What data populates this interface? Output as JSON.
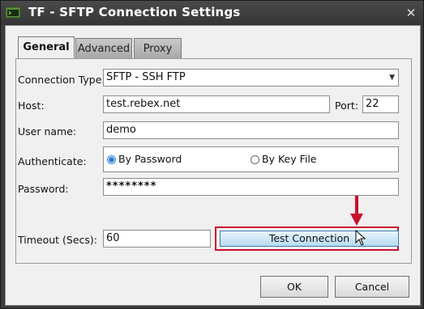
{
  "window": {
    "title": "TF - SFTP Connection Settings",
    "close_glyph": "✕",
    "app_icon": "folder-terminal-icon"
  },
  "tabs": [
    {
      "label": "General",
      "active": true
    },
    {
      "label": "Advanced",
      "active": false
    },
    {
      "label": "Proxy",
      "active": false
    }
  ],
  "form": {
    "connection_type_label": "Connection Type:",
    "connection_type_value": "SFTP - SSH FTP",
    "host_label": "Host:",
    "host_value": "test.rebex.net",
    "port_label": "Port:",
    "port_value": "22",
    "username_label": "User name:",
    "username_value": "demo",
    "authenticate_label": "Authenticate:",
    "auth_options": [
      {
        "label": "By Password",
        "selected": true
      },
      {
        "label": "By Key File",
        "selected": false
      }
    ],
    "password_label": "Password:",
    "password_value": "********",
    "timeout_label": "Timeout (Secs):",
    "timeout_value": "60",
    "test_button_label": "Test Connection"
  },
  "footer": {
    "ok_label": "OK",
    "cancel_label": "Cancel"
  },
  "colors": {
    "highlight": "#c8102e",
    "accent_button": "#b7dcf3"
  }
}
